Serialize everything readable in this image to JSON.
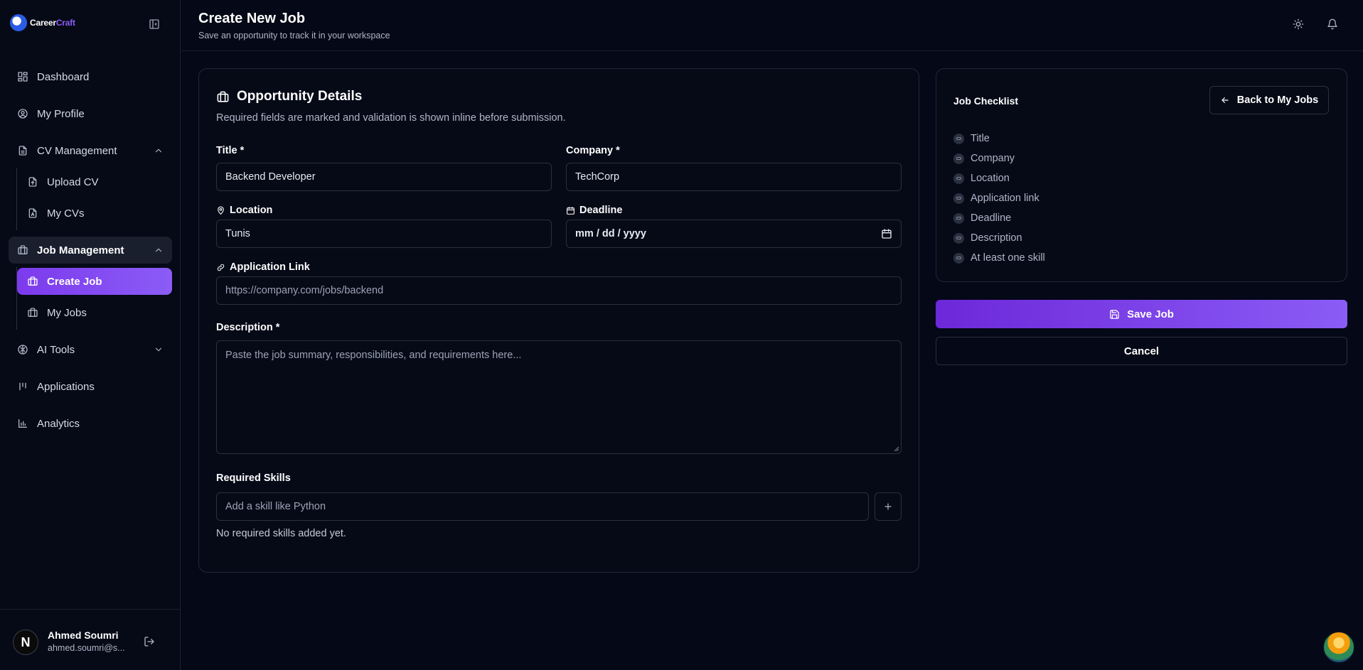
{
  "brand": {
    "name_main": "Career",
    "name_accent": "Craft"
  },
  "sidebar": {
    "items": [
      {
        "label": "Dashboard"
      },
      {
        "label": "My Profile"
      },
      {
        "label": "CV Management",
        "sub": [
          {
            "label": "Upload CV"
          },
          {
            "label": "My CVs"
          }
        ]
      },
      {
        "label": "Job Management",
        "sub": [
          {
            "label": "Create Job"
          },
          {
            "label": "My Jobs"
          }
        ]
      },
      {
        "label": "AI Tools"
      },
      {
        "label": "Applications"
      },
      {
        "label": "Analytics"
      }
    ],
    "user": {
      "initial": "N",
      "name": "Ahmed Soumri",
      "email": "ahmed.soumri@s..."
    }
  },
  "header": {
    "title": "Create New Job",
    "subtitle": "Save an opportunity to track it in your workspace"
  },
  "form": {
    "title": "Opportunity Details",
    "description": "Required fields are marked and validation is shown inline before submission.",
    "title_label": "Title *",
    "title_value": "Backend Developer",
    "company_label": "Company *",
    "company_value": "TechCorp",
    "location_label": "Location",
    "location_value": "Tunis",
    "deadline_label": "Deadline",
    "deadline_value": "mm / dd / yyyy",
    "link_label": "Application Link",
    "link_placeholder": "https://company.com/jobs/backend",
    "description_label": "Description *",
    "description_placeholder": "Paste the job summary, responsibilities, and requirements here...",
    "skills_label": "Required Skills",
    "skills_placeholder": "Add a skill like Python",
    "skills_empty": "No required skills added yet."
  },
  "checklist": {
    "title": "Job Checklist",
    "back_label": "Back to My Jobs",
    "items": [
      "Title",
      "Company",
      "Location",
      "Application link",
      "Deadline",
      "Description",
      "At least one skill"
    ]
  },
  "actions": {
    "save_label": "Save Job",
    "cancel_label": "Cancel"
  },
  "colors": {
    "accent": "#8b5cf6",
    "background": "#050816",
    "border": "#22283a"
  }
}
